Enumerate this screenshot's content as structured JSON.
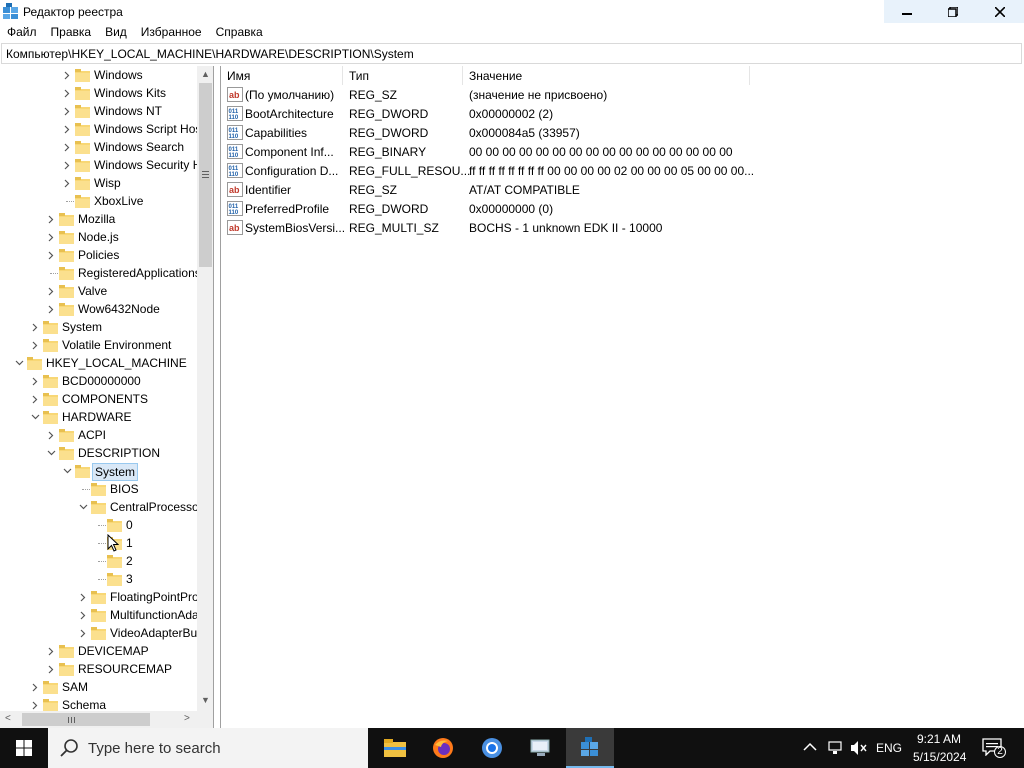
{
  "window": {
    "title": "Редактор реестра"
  },
  "menu": [
    "Файл",
    "Правка",
    "Вид",
    "Избранное",
    "Справка"
  ],
  "address": "Компьютер\\HKEY_LOCAL_MACHINE\\HARDWARE\\DESCRIPTION\\System",
  "tree": [
    {
      "label": "Windows",
      "level": 4,
      "exp": ">"
    },
    {
      "label": "Windows Kits",
      "level": 4,
      "exp": ">"
    },
    {
      "label": "Windows NT",
      "level": 4,
      "exp": ">"
    },
    {
      "label": "Windows Script Host",
      "level": 4,
      "exp": ">"
    },
    {
      "label": "Windows Search",
      "level": 4,
      "exp": ">"
    },
    {
      "label": "Windows Security H",
      "level": 4,
      "exp": ">"
    },
    {
      "label": "Wisp",
      "level": 4,
      "exp": ">"
    },
    {
      "label": "XboxLive",
      "level": 4,
      "exp": ""
    },
    {
      "label": "Mozilla",
      "level": 3,
      "exp": ">"
    },
    {
      "label": "Node.js",
      "level": 3,
      "exp": ">"
    },
    {
      "label": "Policies",
      "level": 3,
      "exp": ">"
    },
    {
      "label": "RegisteredApplications",
      "level": 3,
      "exp": ""
    },
    {
      "label": "Valve",
      "level": 3,
      "exp": ">"
    },
    {
      "label": "Wow6432Node",
      "level": 3,
      "exp": ">"
    },
    {
      "label": "System",
      "level": 2,
      "exp": ">"
    },
    {
      "label": "Volatile Environment",
      "level": 2,
      "exp": ">"
    },
    {
      "label": "HKEY_LOCAL_MACHINE",
      "level": 1,
      "exp": "v"
    },
    {
      "label": "BCD00000000",
      "level": 2,
      "exp": ">"
    },
    {
      "label": "COMPONENTS",
      "level": 2,
      "exp": ">"
    },
    {
      "label": "HARDWARE",
      "level": 2,
      "exp": "v"
    },
    {
      "label": "ACPI",
      "level": 3,
      "exp": ">"
    },
    {
      "label": "DESCRIPTION",
      "level": 3,
      "exp": "v"
    },
    {
      "label": "System",
      "level": 4,
      "exp": "v",
      "selected": true
    },
    {
      "label": "BIOS",
      "level": 5,
      "exp": ""
    },
    {
      "label": "CentralProcessor",
      "level": 5,
      "exp": "v"
    },
    {
      "label": "0",
      "level": 6,
      "exp": ""
    },
    {
      "label": "1",
      "level": 6,
      "exp": ""
    },
    {
      "label": "2",
      "level": 6,
      "exp": ""
    },
    {
      "label": "3",
      "level": 6,
      "exp": ""
    },
    {
      "label": "FloatingPointProcessor",
      "level": 5,
      "exp": ">"
    },
    {
      "label": "MultifunctionAdapter",
      "level": 5,
      "exp": ">"
    },
    {
      "label": "VideoAdapterBusses",
      "level": 5,
      "exp": ">"
    },
    {
      "label": "DEVICEMAP",
      "level": 3,
      "exp": ">"
    },
    {
      "label": "RESOURCEMAP",
      "level": 3,
      "exp": ">"
    },
    {
      "label": "SAM",
      "level": 2,
      "exp": ">"
    },
    {
      "label": "Schema",
      "level": 2,
      "exp": ">"
    }
  ],
  "columns": {
    "name": "Имя",
    "type": "Тип",
    "data": "Значение"
  },
  "values": [
    {
      "icon": "string",
      "name": "(По умолчанию)",
      "type": "REG_SZ",
      "data": "(значение не присвоено)"
    },
    {
      "icon": "binary",
      "name": "BootArchitecture",
      "type": "REG_DWORD",
      "data": "0x00000002 (2)"
    },
    {
      "icon": "binary",
      "name": "Capabilities",
      "type": "REG_DWORD",
      "data": "0x000084a5 (33957)"
    },
    {
      "icon": "binary",
      "name": "Component Inf...",
      "type": "REG_BINARY",
      "data": "00 00 00 00 00 00 00 00 00 00 00 00 00 00 00 00"
    },
    {
      "icon": "binary",
      "name": "Configuration D...",
      "type": "REG_FULL_RESOU...",
      "data": "ff ff ff ff ff ff ff ff 00 00 00 00 02 00 00 00 05 00 00 00..."
    },
    {
      "icon": "string",
      "name": "Identifier",
      "type": "REG_SZ",
      "data": "AT/AT COMPATIBLE"
    },
    {
      "icon": "binary",
      "name": "PreferredProfile",
      "type": "REG_DWORD",
      "data": "0x00000000 (0)"
    },
    {
      "icon": "string",
      "name": "SystemBiosVersi...",
      "type": "REG_MULTI_SZ",
      "data": "BOCHS  - 1 unknown EDK II - 10000"
    }
  ],
  "taskbar": {
    "search_placeholder": "Type here to search",
    "lang": "ENG",
    "time": "9:21 AM",
    "date": "5/15/2024",
    "notification_count": "2"
  }
}
